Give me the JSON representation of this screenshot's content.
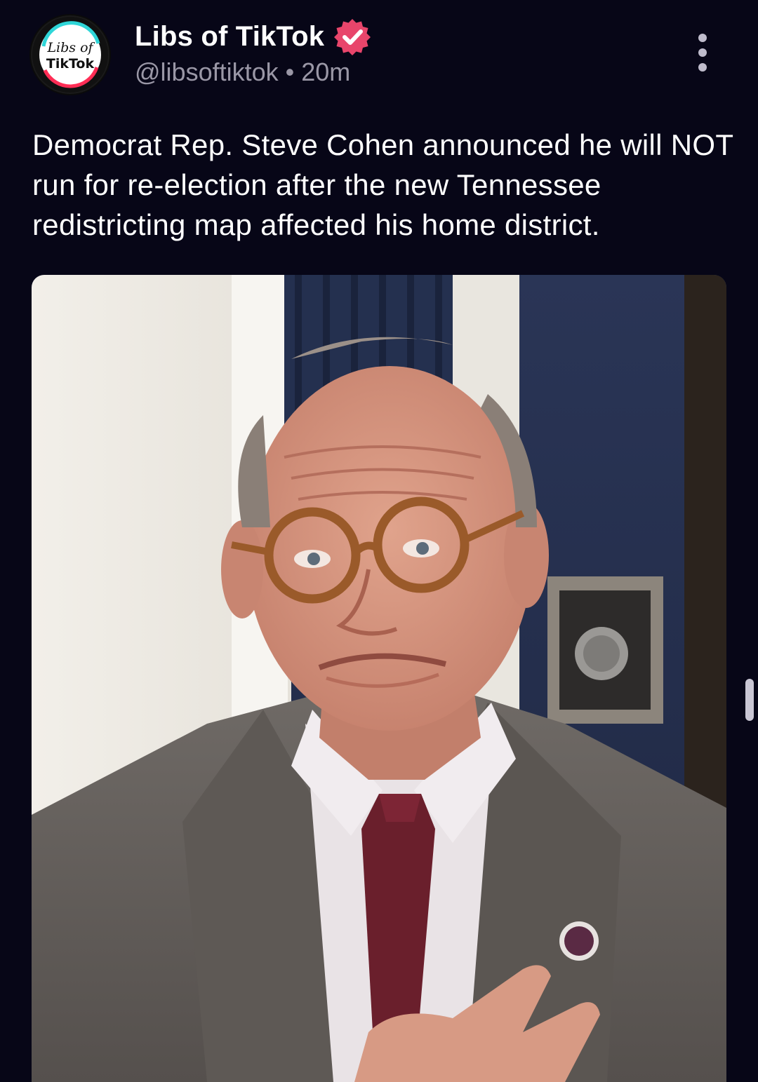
{
  "post": {
    "display_name": "Libs of TikTok",
    "handle": "@libsoftiktok",
    "separator": "•",
    "timestamp": "20m",
    "text": "Democrat Rep. Steve Cohen announced he will NOT run for re-election after the new Tennessee redistricting map affected his home district.",
    "avatar_lines": [
      "Libs of",
      "TikTok"
    ],
    "media_icon": "photo-of-man-in-glasses"
  },
  "icons": {
    "verified": "verified-badge-icon",
    "more": "more-vertical-icon"
  },
  "colors": {
    "background": "#070617",
    "text": "#ffffff",
    "secondary_text": "#9a97a6",
    "verified_badge": "#e8456b"
  }
}
